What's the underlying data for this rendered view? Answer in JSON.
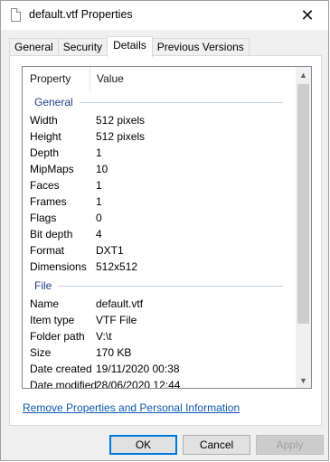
{
  "window": {
    "title": "default.vtf Properties",
    "close_glyph": "✕"
  },
  "tabs": [
    {
      "label": "General",
      "active": false
    },
    {
      "label": "Security",
      "active": false
    },
    {
      "label": "Details",
      "active": true
    },
    {
      "label": "Previous Versions",
      "active": false
    }
  ],
  "details": {
    "header_property": "Property",
    "header_value": "Value",
    "groups": [
      {
        "name": "General",
        "rows": [
          {
            "key": "Width",
            "value": "512 pixels"
          },
          {
            "key": "Height",
            "value": "512 pixels"
          },
          {
            "key": "Depth",
            "value": "1"
          },
          {
            "key": "MipMaps",
            "value": "10"
          },
          {
            "key": "Faces",
            "value": "1"
          },
          {
            "key": "Frames",
            "value": "1"
          },
          {
            "key": "Flags",
            "value": "0"
          },
          {
            "key": "Bit depth",
            "value": "4"
          },
          {
            "key": "Format",
            "value": "DXT1"
          },
          {
            "key": "Dimensions",
            "value": "512x512"
          }
        ]
      },
      {
        "name": "File",
        "rows": [
          {
            "key": "Name",
            "value": "default.vtf"
          },
          {
            "key": "Item type",
            "value": "VTF File"
          },
          {
            "key": "Folder path",
            "value": "V:\\t"
          },
          {
            "key": "Size",
            "value": "170 KB"
          },
          {
            "key": "Date created",
            "value": "19/11/2020 00:38"
          },
          {
            "key": "Date modified",
            "value": "28/06/2020 12:44"
          }
        ]
      }
    ]
  },
  "remove_link": "Remove Properties and Personal Information",
  "buttons": {
    "ok": "OK",
    "cancel": "Cancel",
    "apply": "Apply"
  },
  "icons": {
    "title": "document-icon",
    "close": "close-icon",
    "scroll_up": "chevron-up-icon",
    "scroll_down": "chevron-down-icon"
  }
}
